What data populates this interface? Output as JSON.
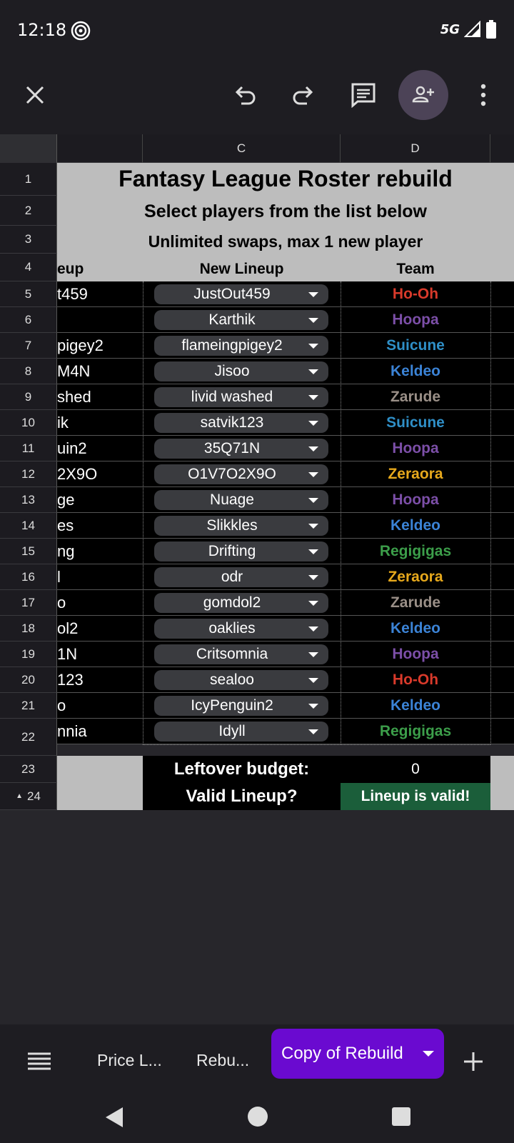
{
  "status": {
    "time": "12:18",
    "network": "5G"
  },
  "sheet": {
    "columns": [
      "C",
      "D"
    ],
    "title": "Fantasy League Roster rebuild",
    "subtitle": "Select players from the list below",
    "rules": "Unlimited swaps, max 1 new player",
    "header_b": "eup",
    "header_c": "New Lineup",
    "header_d": "Team",
    "row_numbers": [
      "1",
      "2",
      "3",
      "4",
      "5",
      "6",
      "7",
      "8",
      "9",
      "10",
      "11",
      "12",
      "13",
      "14",
      "15",
      "16",
      "17",
      "18",
      "19",
      "20",
      "21",
      "22",
      "23",
      "24"
    ],
    "rows": [
      {
        "b": "t459",
        "c": "JustOut459",
        "team": "Ho-Oh",
        "color": "#d93a2b"
      },
      {
        "b": "",
        "c": "Karthik",
        "team": "Hoopa",
        "color": "#7c4fa8"
      },
      {
        "b": "pigey2",
        "c": "flameingpigey2",
        "team": "Suicune",
        "color": "#2f8fc7"
      },
      {
        "b": "M4N",
        "c": "Jisoo",
        "team": "Keldeo",
        "color": "#3b83d6"
      },
      {
        "b": "shed",
        "c": "livid washed",
        "team": "Zarude",
        "color": "#9a8f87"
      },
      {
        "b": "ik",
        "c": "satvik123",
        "team": "Suicune",
        "color": "#2f8fc7"
      },
      {
        "b": "uin2",
        "c": "35Q71N",
        "team": "Hoopa",
        "color": "#7c4fa8"
      },
      {
        "b": "2X9O",
        "c": "O1V7O2X9O",
        "team": "Zeraora",
        "color": "#e6a81c"
      },
      {
        "b": "ge",
        "c": "Nuage",
        "team": "Hoopa",
        "color": "#7c4fa8"
      },
      {
        "b": "es",
        "c": "Slikkles",
        "team": "Keldeo",
        "color": "#3b83d6"
      },
      {
        "b": "ng",
        "c": "Drifting",
        "team": "Regigigas",
        "color": "#3c9e4a"
      },
      {
        "b": "l",
        "c": "odr",
        "team": "Zeraora",
        "color": "#e6a81c"
      },
      {
        "b": "o",
        "c": "gomdol2",
        "team": "Zarude",
        "color": "#9a8f87"
      },
      {
        "b": "ol2",
        "c": "oaklies",
        "team": "Keldeo",
        "color": "#3b83d6"
      },
      {
        "b": "1N",
        "c": "Critsomnia",
        "team": "Hoopa",
        "color": "#7c4fa8"
      },
      {
        "b": "123",
        "c": "sealoo",
        "team": "Ho-Oh",
        "color": "#d93a2b"
      },
      {
        "b": "o",
        "c": "IcyPenguin2",
        "team": "Keldeo",
        "color": "#3b83d6"
      },
      {
        "b": "nnia",
        "c": "Idyll",
        "team": "Regigigas",
        "color": "#3c9e4a"
      }
    ],
    "leftover_label": "Leftover budget:",
    "leftover_value": "0",
    "valid_label": "Valid Lineup?",
    "valid_value": "Lineup is valid!"
  },
  "tabs": {
    "t1": "Price L...",
    "t2": "Rebu...",
    "active": "Copy of Rebuild"
  },
  "colors": {
    "accent": "#6a0ad0",
    "valid_bg": "#1b5e3a"
  }
}
